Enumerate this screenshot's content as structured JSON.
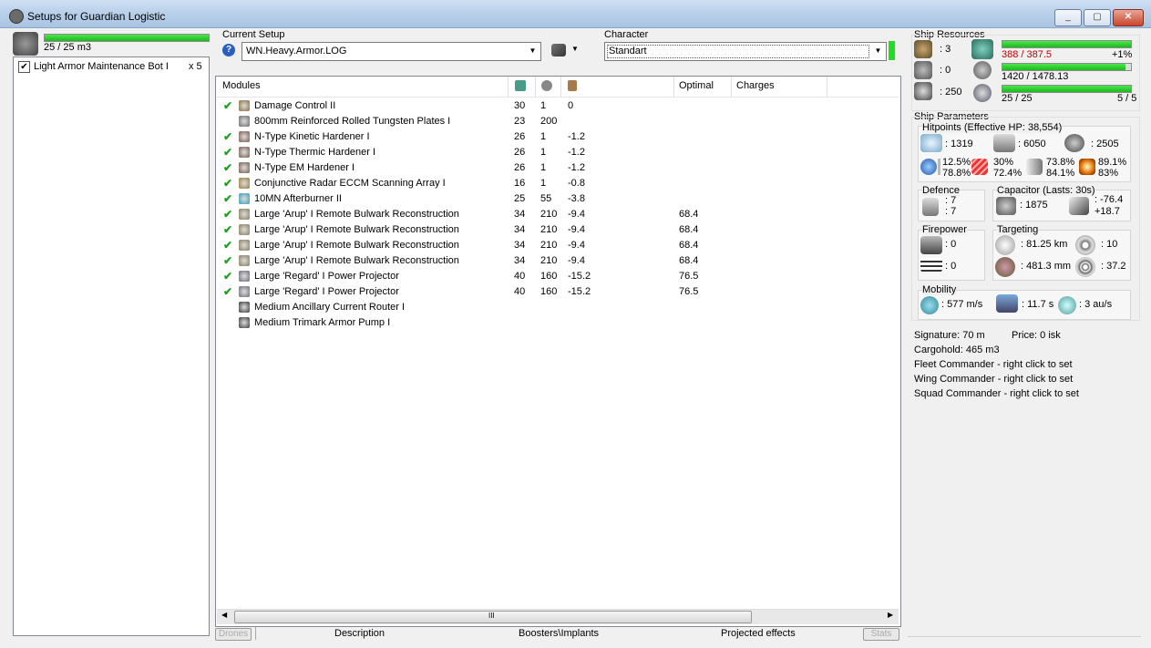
{
  "window": {
    "title": "Setups for Guardian Logistic",
    "buttons": [
      "_",
      "▢",
      "✕"
    ]
  },
  "drones": {
    "bandwidth_text": "25 / 25 m3",
    "bandwidth_fill": 1.0,
    "items": [
      {
        "name": "Light Armor Maintenance Bot I",
        "count": "x 5",
        "checked": true
      }
    ]
  },
  "setup": {
    "label": "Current Setup",
    "value": "WN.Heavy.Armor.LOG"
  },
  "character": {
    "label": "Character",
    "value": "Standart"
  },
  "modules": {
    "columns": [
      "Modules",
      "",
      "",
      "",
      "Optimal",
      "Charges"
    ],
    "column_icons": [
      "cpu-icon",
      "powergrid-icon",
      "capacitor-icon"
    ],
    "rows": [
      {
        "check": "✔",
        "name": "Damage Control II",
        "cpu": "30",
        "pg": "1",
        "cap": "0",
        "optimal": "",
        "icon_color": "#8a6a3a"
      },
      {
        "check": "",
        "name": "800mm Reinforced Rolled Tungsten Plates I",
        "cpu": "23",
        "pg": "200",
        "cap": "",
        "optimal": "",
        "icon_color": "#6a6a6a"
      },
      {
        "check": "✔",
        "name": "N-Type Kinetic Hardener I",
        "cpu": "26",
        "pg": "1",
        "cap": "-1.2",
        "optimal": "",
        "icon_color": "#7a5a4a"
      },
      {
        "check": "✔",
        "name": "N-Type Thermic Hardener I",
        "cpu": "26",
        "pg": "1",
        "cap": "-1.2",
        "optimal": "",
        "icon_color": "#7a5a4a"
      },
      {
        "check": "✔",
        "name": "N-Type EM Hardener I",
        "cpu": "26",
        "pg": "1",
        "cap": "-1.2",
        "optimal": "",
        "icon_color": "#7a5a4a"
      },
      {
        "check": "✔",
        "name": "Conjunctive Radar ECCM Scanning Array I",
        "cpu": "16",
        "pg": "1",
        "cap": "-0.8",
        "optimal": "",
        "icon_color": "#9a7a3a"
      },
      {
        "check": "✔",
        "name": "10MN Afterburner II",
        "cpu": "25",
        "pg": "55",
        "cap": "-3.8",
        "optimal": "",
        "icon_color": "#3a9aba"
      },
      {
        "check": "✔",
        "name": "Large 'Arup' I Remote Bulwark Reconstruction",
        "cpu": "34",
        "pg": "210",
        "cap": "-9.4",
        "optimal": "68.4",
        "icon_color": "#8a7a5a"
      },
      {
        "check": "✔",
        "name": "Large 'Arup' I Remote Bulwark Reconstruction",
        "cpu": "34",
        "pg": "210",
        "cap": "-9.4",
        "optimal": "68.4",
        "icon_color": "#8a7a5a"
      },
      {
        "check": "✔",
        "name": "Large 'Arup' I Remote Bulwark Reconstruction",
        "cpu": "34",
        "pg": "210",
        "cap": "-9.4",
        "optimal": "68.4",
        "icon_color": "#8a7a5a"
      },
      {
        "check": "✔",
        "name": "Large 'Arup' I Remote Bulwark Reconstruction",
        "cpu": "34",
        "pg": "210",
        "cap": "-9.4",
        "optimal": "68.4",
        "icon_color": "#8a7a5a"
      },
      {
        "check": "✔",
        "name": "Large 'Regard' I Power Projector",
        "cpu": "40",
        "pg": "160",
        "cap": "-15.2",
        "optimal": "76.5",
        "icon_color": "#6a6a7a"
      },
      {
        "check": "✔",
        "name": "Large 'Regard' I Power Projector",
        "cpu": "40",
        "pg": "160",
        "cap": "-15.2",
        "optimal": "76.5",
        "icon_color": "#6a6a7a"
      },
      {
        "check": "",
        "name": "Medium Ancillary Current Router I",
        "cpu": "",
        "pg": "",
        "cap": "",
        "optimal": "",
        "icon_color": "#3a3a3a"
      },
      {
        "check": "",
        "name": "Medium Trimark Armor Pump I",
        "cpu": "",
        "pg": "",
        "cap": "",
        "optimal": "",
        "icon_color": "#3a3a3a"
      }
    ]
  },
  "scrollbar": {
    "grip": "III"
  },
  "bottom_tabs": {
    "drones": "Drones",
    "description": "Description",
    "boosters": "Boosters\\Implants",
    "projected": "Projected effects",
    "stats": "Stats"
  },
  "resources": {
    "title": "Ship Resources",
    "hardpoints": {
      "turret": ": 3",
      "launcher": ": 0",
      "calibration": ": 250"
    },
    "cpu": {
      "text": "388 / 387.5",
      "extra": "+1%",
      "fill": 1.0,
      "color": "#c00000"
    },
    "powergrid": {
      "text": "1420 / 1478.13",
      "extra": "",
      "fill": 0.96
    },
    "slots": {
      "text": "25 / 25",
      "extra": "5 / 5",
      "fill": 1.0
    }
  },
  "parameters": {
    "title": "Ship Parameters",
    "hitpoints_title": "Hitpoints (Effective HP: 38,554)",
    "shield_hp": ": 1319",
    "armor_hp": ": 6050",
    "structure_hp": ": 2505",
    "resists": [
      {
        "a": "12.5%",
        "b": "78.8%"
      },
      {
        "a": "30%",
        "b": "72.4%"
      },
      {
        "a": "73.8%",
        "b": "84.1%"
      },
      {
        "a": "89.1%",
        "b": "83%"
      }
    ],
    "defence": {
      "title": "Defence",
      "a": ": 7",
      "b": ": 7"
    },
    "capacitor": {
      "title": "Capacitor (Lasts: 30s)",
      "amount": ": 1875",
      "a": ": -76.4",
      "b": "+18.7"
    },
    "firepower": {
      "title": "Firepower",
      "a": ": 0",
      "b": ": 0"
    },
    "targeting": {
      "title": "Targeting",
      "range": ": 81.25 km",
      "targets": ": 10",
      "resolution": ": 481.3 mm",
      "sensor": ": 37.2"
    },
    "mobility": {
      "title": "Mobility",
      "speed": ": 577 m/s",
      "align": ": 11.7 s",
      "warp": ": 3 au/s"
    }
  },
  "info": {
    "signature": "Signature: 70 m",
    "price": "Price: 0 isk",
    "cargo": "Cargohold: 465 m3",
    "fleet": "Fleet Commander - right click to set",
    "wing": "Wing Commander - right click to set",
    "squad": "Squad Commander - right click to set"
  }
}
